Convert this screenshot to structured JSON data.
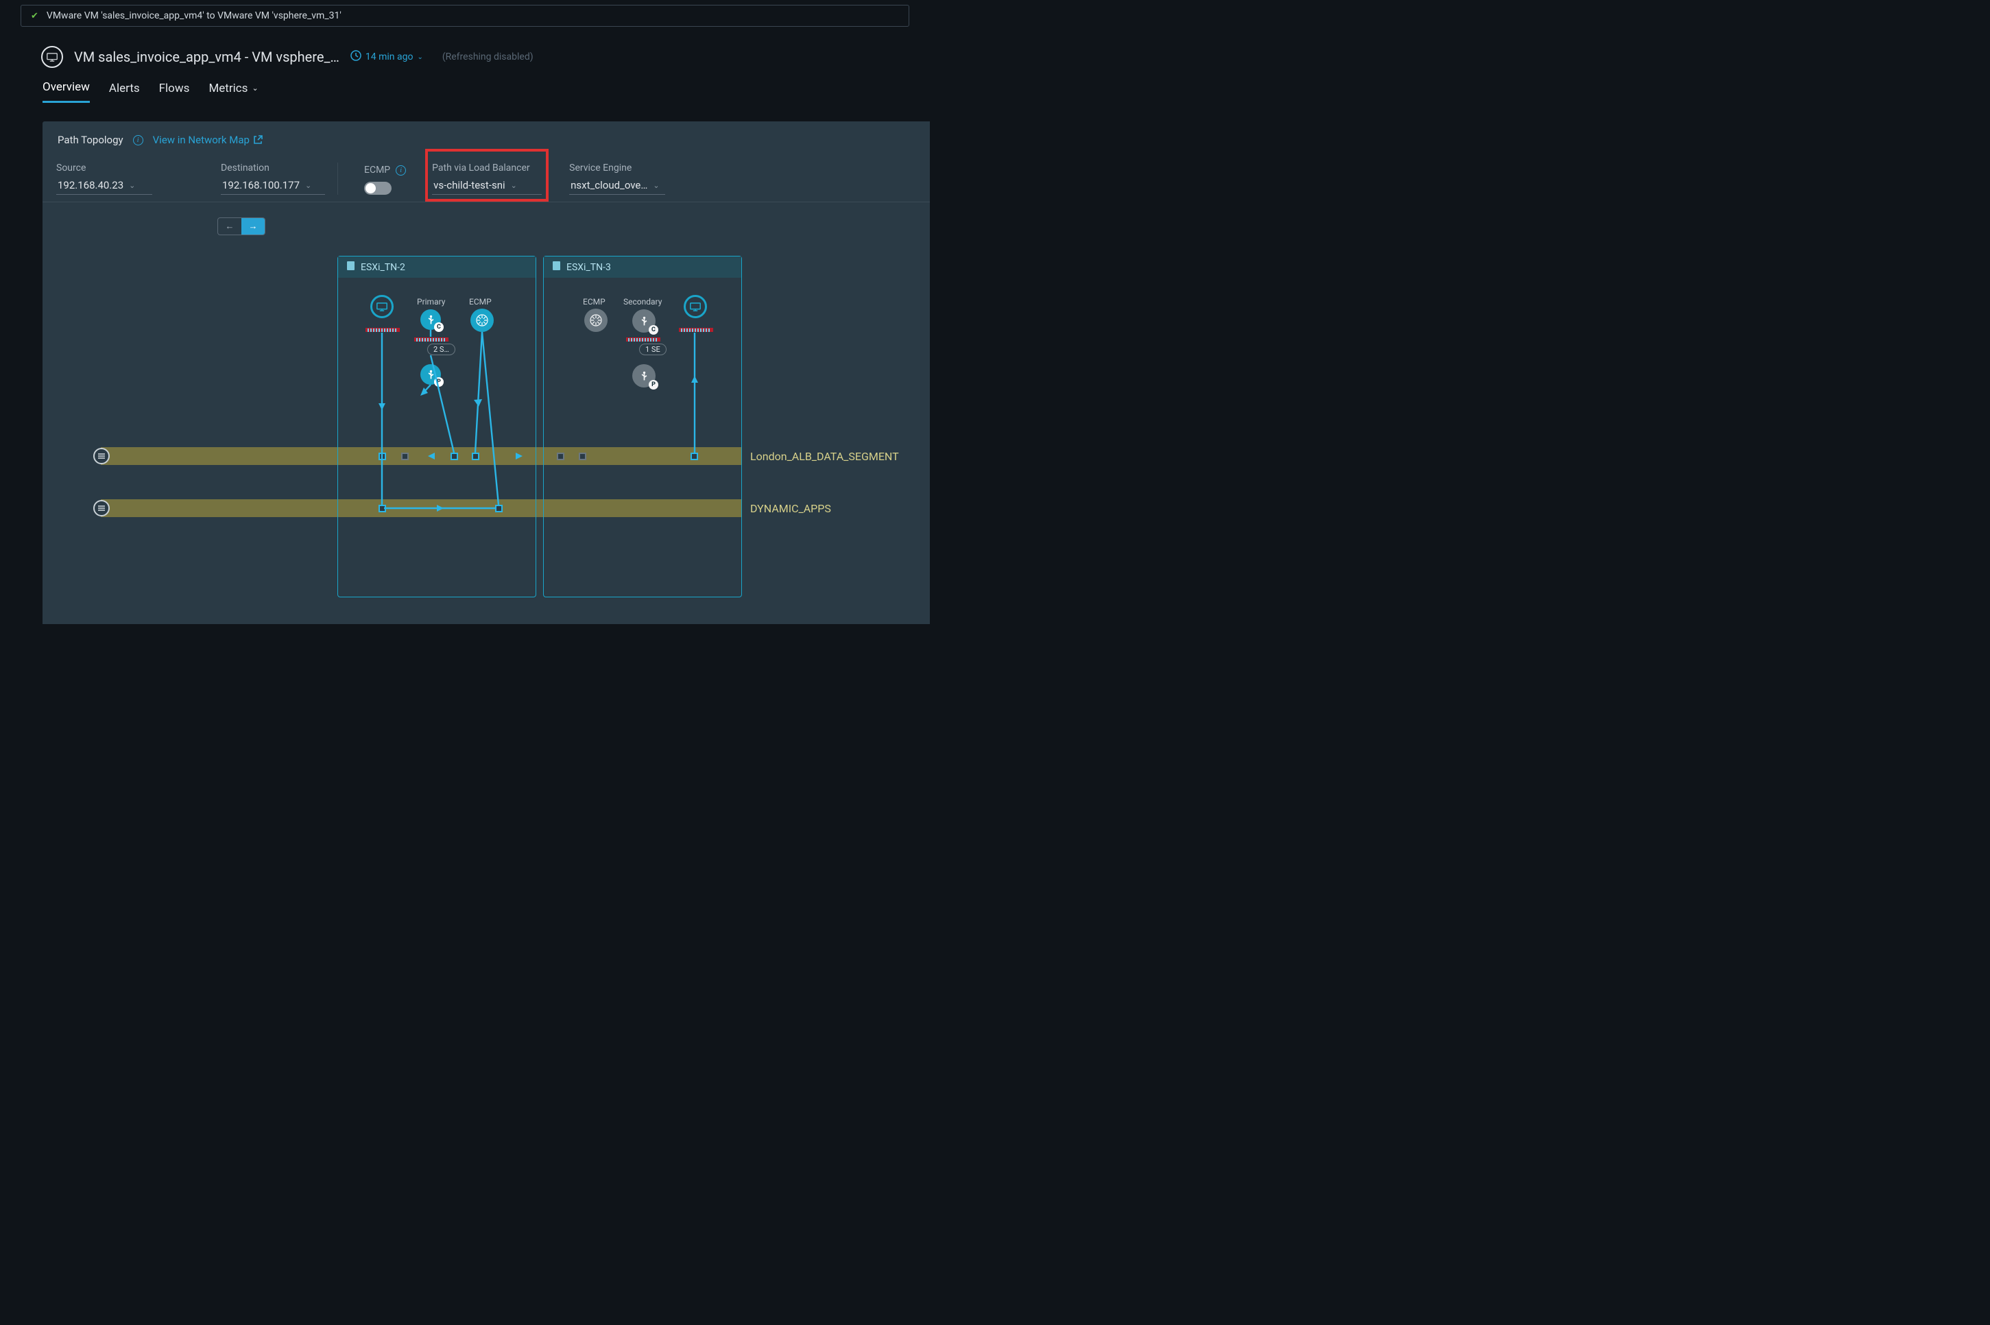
{
  "breadcrumb": "VMware VM 'sales_invoice_app_vm4' to VMware VM 'vsphere_vm_31'",
  "page_title": "VM sales_invoice_app_vm4 - VM vsphere_…",
  "time_ago": "14 min ago",
  "refresh_note": "(Refreshing  disabled)",
  "tabs": {
    "overview": "Overview",
    "alerts": "Alerts",
    "flows": "Flows",
    "metrics": "Metrics"
  },
  "panel": {
    "title": "Path Topology",
    "net_link": "View in Network Map"
  },
  "filters": {
    "source_label": "Source",
    "source_value": "192.168.40.23",
    "dest_label": "Destination",
    "dest_value": "192.168.100.177",
    "ecmp_label": "ECMP",
    "lb_label": "Path via Load Balancer",
    "lb_value": "vs-child-test-sni",
    "se_label": "Service Engine",
    "se_value": "nsxt_cloud_ove…"
  },
  "topology": {
    "host1": "ESXi_TN-2",
    "host2": "ESXi_TN-3",
    "primary_label": "Primary",
    "secondary_label": "Secondary",
    "ecmp_label": "ECMP",
    "pill1": "2 S…",
    "pill2": "1 SE",
    "segment1": "London_ALB_DATA_SEGMENT",
    "segment2": "DYNAMIC_APPS"
  }
}
